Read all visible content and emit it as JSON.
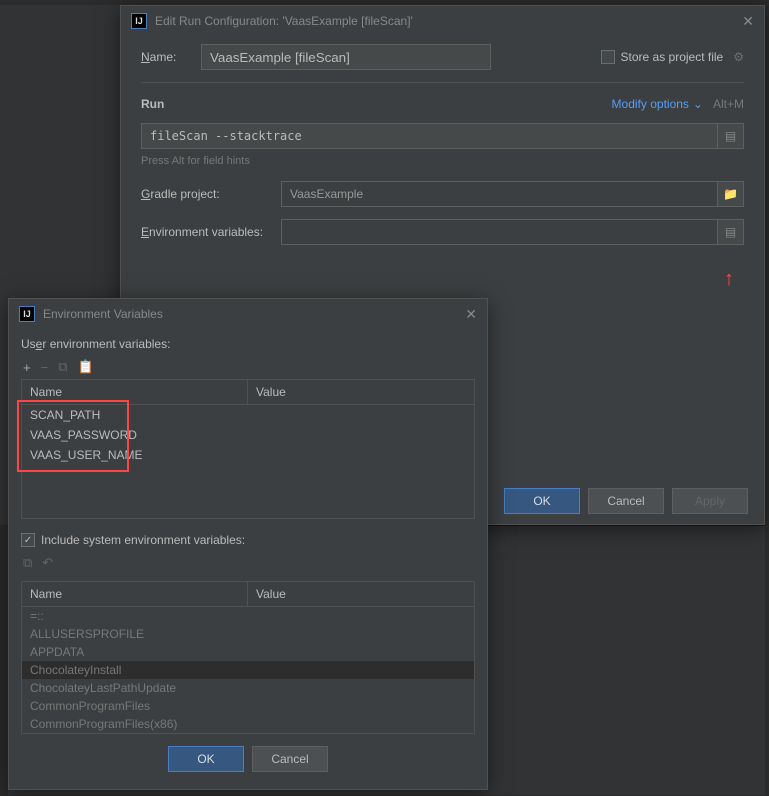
{
  "main": {
    "title": "Edit Run Configuration: 'VaasExample [fileScan]'",
    "name_label": "Name:",
    "name_value": "VaasExample [fileScan]",
    "store_label": "Store as project file",
    "run_section": "Run",
    "modify_options": "Modify options",
    "modify_shortcut": "Alt+M",
    "tasks_value": "fileScan --stacktrace",
    "hint": "Press Alt for field hints",
    "gradle_label": "Gradle project:",
    "gradle_value": "VaasExample",
    "env_label": "Environment variables:",
    "ok": "OK",
    "cancel": "Cancel",
    "apply": "Apply"
  },
  "env": {
    "title": "Environment Variables",
    "user_label": "User environment variables:",
    "col_name": "Name",
    "col_value": "Value",
    "user_vars": [
      {
        "name": "SCAN_PATH",
        "value": ""
      },
      {
        "name": "VAAS_PASSWORD",
        "value": ""
      },
      {
        "name": "VAAS_USER_NAME",
        "value": ""
      }
    ],
    "include_label": "Include system environment variables:",
    "sys_vars": [
      {
        "name": "=::",
        "value": ""
      },
      {
        "name": "ALLUSERSPROFILE",
        "value": ""
      },
      {
        "name": "APPDATA",
        "value": ""
      },
      {
        "name": "ChocolateyInstall",
        "value": ""
      },
      {
        "name": "ChocolateyLastPathUpdate",
        "value": ""
      },
      {
        "name": "CommonProgramFiles",
        "value": ""
      },
      {
        "name": "CommonProgramFiles(x86)",
        "value": ""
      }
    ],
    "ok": "OK",
    "cancel": "Cancel"
  }
}
